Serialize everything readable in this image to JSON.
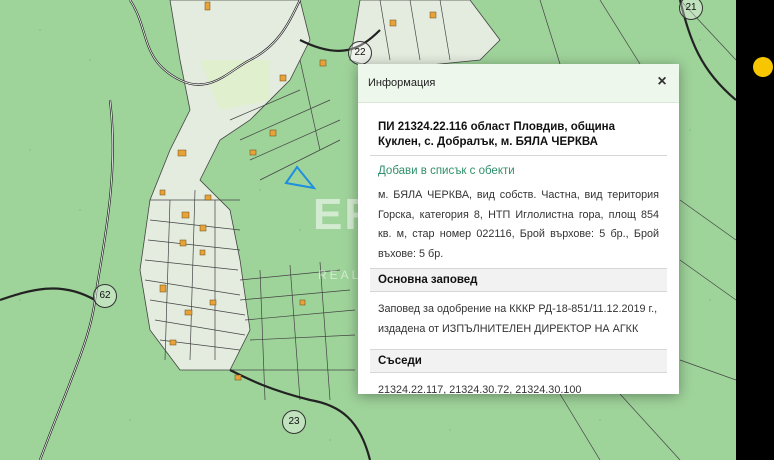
{
  "map": {
    "road_labels": [
      "21",
      "22",
      "62",
      "23"
    ]
  },
  "panel": {
    "title": "Информация",
    "close_symbol": "×",
    "property_title": "ПИ 21324.22.116 област Пловдив, община Куклен, с. Добралък, м. БЯЛА ЧЕРКВА",
    "add_link": "Добави в списък с обекти",
    "description": "м. БЯЛА ЧЕРКВА, вид собств. Частна, вид територия Горска, категория 8, НТП Иглолистна гора, площ 854 кв. м, стар номер 022116, Брой върхове: 5 бр., Брой въхове: 5 бр.",
    "sections": {
      "order_heading": "Основна заповед",
      "order_text": "Заповед за одобрение на КККР РД-18-851/11.12.2019 г., издадена от ИЗПЪЛНИТЕЛЕН ДИРЕКТОР НА АГКК",
      "neighbors_heading": "Съседи",
      "neighbors_text": "21324.22.117, 21324.30.72, 21324.30.100"
    }
  },
  "watermark": {
    "logo_text": "ERA",
    "subtitle": "REAL ESTATE"
  },
  "colors": {
    "map_background": "#9ed39a",
    "settlement_area": "#e4ecdf",
    "link": "#2f8f6a",
    "status_dot": "#f7c600",
    "selected_parcel": "#1e8fe0"
  }
}
